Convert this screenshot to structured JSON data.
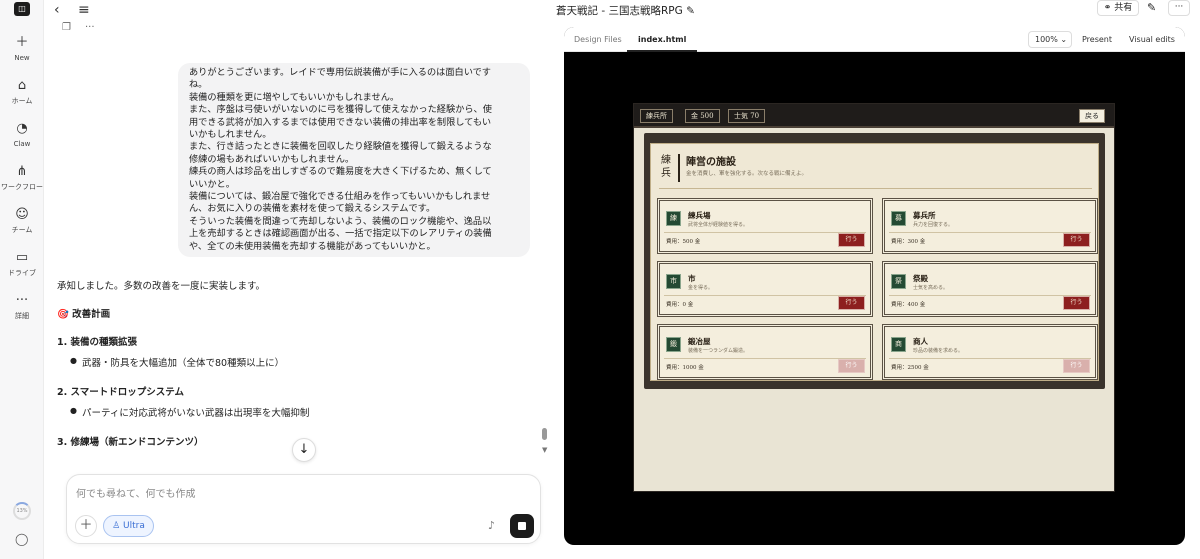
{
  "sidebar": {
    "items": [
      {
        "label": "New",
        "icon": "plus-icon"
      },
      {
        "label": "ホーム",
        "icon": "home-icon"
      },
      {
        "label": "Claw",
        "icon": "claw-icon"
      },
      {
        "label": "ワークフロー",
        "icon": "workflow-icon"
      },
      {
        "label": "チーム",
        "icon": "team-icon"
      },
      {
        "label": "ドライブ",
        "icon": "folder-icon"
      },
      {
        "label": "詳細",
        "icon": "more-icon"
      }
    ],
    "usage": "13%"
  },
  "chat": {
    "user_message": [
      "ありがとうございます。レイドで専用伝説装備が手に入るのは面白いです",
      "ね。",
      "装備の種類を更に増やしてもいいかもしれません。",
      "また、序盤は弓使いがいないのに弓を獲得して使えなかった経験から、使",
      "用できる武将が加入するまでは使用できない装備の排出率を制限してもい",
      "いかもしれません。",
      "また、行き詰ったときに装備を回収したり経験値を獲得して鍛えるような",
      "修練の場もあればいいかもしれません。",
      "練兵の商人は珍品を出しすぎるので難易度を大きく下げるため、無くして",
      "いいかと。",
      "装備については、鍛冶屋で強化できる仕組みを作ってもいいかもしれませ",
      "ん、お気に入りの装備を素材を使って鍛えるシステムです。",
      "そういった装備を間違って売却しないよう、装備のロック機能や、逸品以",
      "上を売却するときは確認画面が出る、一括で指定以下のレアリティの装備",
      "や、全ての未使用装備を売却する機能があってもいいかと。"
    ],
    "reply_intro": "承知しました。多数の改善を一度に実装します。",
    "plan_title": "🎯 改善計画",
    "sections": [
      {
        "title": "1. 装備の種類拡張",
        "bullet": "武器・防具を大幅追加（全体で80種類以上に）"
      },
      {
        "title": "2. スマートドロップシステム",
        "bullet": "パーティに対応武将がいない武器は出現率を大幅抑制"
      },
      {
        "title": "3. 修練場（新エンドコンテンツ）",
        "bullet": ""
      }
    ],
    "input_placeholder": "何でも尋ねて、何でも作成",
    "mode_label": "Ultra"
  },
  "header": {
    "title": "蒼天戦記 - 三国志戦略RPG",
    "share_label": "共有"
  },
  "preview": {
    "tabs": [
      "Design Files",
      "index.html"
    ],
    "zoom": "100%",
    "present_label": "Present",
    "visual_edits_label": "Visual edits"
  },
  "game": {
    "chips": [
      "練兵所",
      "金 500",
      "士気 70"
    ],
    "back_label": "戻る",
    "vertical_title": "練兵",
    "board_title": "陣営の施設",
    "board_subtitle": "金を消費し、軍を強化する。次なる戦に備えよ。",
    "cards": [
      {
        "kanji": "練",
        "name": "練兵場",
        "desc": "武将全体が経験値を得る。",
        "cost": "費用：500 金",
        "action": "行う",
        "enabled": true
      },
      {
        "kanji": "募",
        "name": "募兵所",
        "desc": "兵力を回復する。",
        "cost": "費用：300 金",
        "action": "行う",
        "enabled": true
      },
      {
        "kanji": "市",
        "name": "市",
        "desc": "金を得る。",
        "cost": "費用：0 金",
        "action": "行う",
        "enabled": true
      },
      {
        "kanji": "祭",
        "name": "祭殿",
        "desc": "士気を高める。",
        "cost": "費用：400 金",
        "action": "行う",
        "enabled": true
      },
      {
        "kanji": "鍛",
        "name": "鍛冶屋",
        "desc": "装備を一つランダム鍛造。",
        "cost": "費用：1000 金",
        "action": "行う",
        "enabled": false
      },
      {
        "kanji": "商",
        "name": "商人",
        "desc": "珍品の装備を求める。",
        "cost": "費用：2500 金",
        "action": "行う",
        "enabled": false
      }
    ]
  }
}
